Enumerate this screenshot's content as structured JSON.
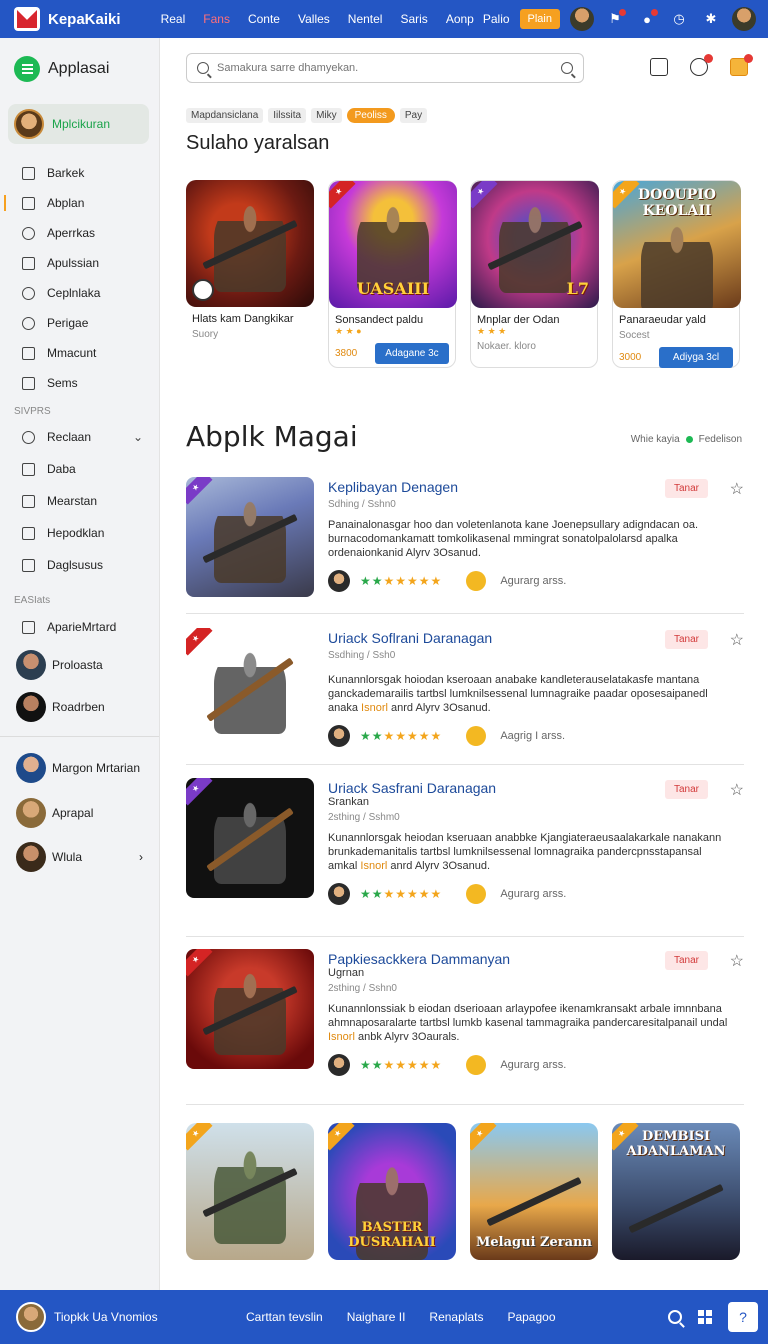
{
  "topbar": {
    "brand": "KepaKaiki",
    "nav": [
      "Real",
      "Fans",
      "Conte",
      "Valles",
      "Nentel",
      "Saris",
      "Aonp"
    ],
    "active_index": 1,
    "right_label": "Palio",
    "button": "Plain"
  },
  "sidebar": {
    "title": "Applasai",
    "user": "Mplcikuran",
    "items": [
      {
        "label": "Barkek",
        "icon": "square-icon"
      },
      {
        "label": "Abplan",
        "icon": "doc-icon"
      },
      {
        "label": "Aperrkas",
        "icon": "person-icon"
      },
      {
        "label": "Apulssian",
        "icon": "bag-icon"
      },
      {
        "label": "Ceplnlaka",
        "icon": "circle-icon"
      },
      {
        "label": "Perigae",
        "icon": "pin-icon"
      },
      {
        "label": "Mmacunt",
        "icon": "grid-icon"
      },
      {
        "label": "Sems",
        "icon": "list-icon"
      }
    ],
    "section1": "SIVPRS",
    "items2": [
      {
        "label": "Reclaan",
        "icon": "search-icon"
      },
      {
        "label": "Daba",
        "icon": "clipboard-icon"
      },
      {
        "label": "Mearstan",
        "icon": "square-icon"
      },
      {
        "label": "Hepodklan",
        "icon": "doc-icon"
      },
      {
        "label": "Daglsusus",
        "icon": "list-icon"
      }
    ],
    "section2": "EASIats",
    "items3": [
      {
        "label": "AparieMrtard",
        "icon": "square-icon"
      }
    ],
    "friends": [
      "Proloasta",
      "Roadrben"
    ],
    "friends2": [
      "Margon Mrtarian",
      "Aprapal",
      "Wlula"
    ]
  },
  "main": {
    "search_placeholder": "Samakura sarre dhamyekan.",
    "chips": [
      "Mapdansiclana",
      "Iilssita",
      "Miky",
      "Peoliss",
      "Pay"
    ],
    "chip_active": 3,
    "featured_title": "Sulaho yaralsan",
    "featured": [
      {
        "title": "Hlats kam Dangkikar",
        "sub": "Suory",
        "price": "",
        "button": "",
        "art_text": ""
      },
      {
        "title": "Sonsandect paldu",
        "sub": "",
        "price": "3800",
        "button": "Adagane 3c",
        "art_text": "UASAIII"
      },
      {
        "title": "Mnplar der Odan",
        "sub": "",
        "price": "Nokaer. kloro",
        "button": "",
        "art_text": "L7"
      },
      {
        "title": "Panaraeudar yald",
        "sub": "Socest",
        "price": "3000",
        "button": "Adiyga 3cl",
        "art_text": "DOOUPIO KEOLAII"
      }
    ],
    "section_title": "Abplk Magai",
    "legend": "Whie kayia",
    "legend2": "Fedelison",
    "list": [
      {
        "title": "Keplibayan Denagen",
        "sub": "",
        "meta": "Sdhing / Sshn0",
        "desc": "Panainalonasgar hoo dan voletenlanota kane Joenepsullary adigndacan oa. burnacodomankamatt tomkolikasenal mmingrat sonatolpalolarsd apalka ordenaionkanid Alyrv 3Osanud.",
        "tag": "",
        "foot": "Agurarg arss.",
        "button": "Tanar"
      },
      {
        "title": "Uriack Soflrani Daranagan",
        "sub": "",
        "meta": "Ssdhing / Ssh0",
        "desc": "Kunannlorsgak hoiodan kseroaan anabake kandleterauselatakasfe mantana ganckademarailis tartbsl lumknilsessenal lumnagraike paadar oposesaipanedl anaka",
        "tag": "Isnorl",
        "foot_desc": "anrd Alyrv 3Osanud.",
        "foot": "Aagrig I arss.",
        "button": "Tanar"
      },
      {
        "title": "Uriack Sasfrani Daranagan",
        "sub": "Srankan",
        "meta": "2sthing / Sshm0",
        "desc": "Kunannlorsgak heiodan kseruaan anabbke Kjangiateraeusaalakarkale nanakann brunkademanitalis tartbsl lumknilsessenal lomnagraika pandercpnsstapansal amkal",
        "tag": "Isnorl",
        "foot_desc": "anrd Alyrv 3Osanud.",
        "foot": "Agurarg arss.",
        "button": "Tanar"
      },
      {
        "title": "Papkiesackkera Dammanyan",
        "sub": "Ugrnan",
        "meta": "2sthing / Sshn0",
        "desc": "Kunannlonssiak b eiodan dserioaan arlaypofee ikenamkransakt arbale imnnbana ahmnaposaralarte tartbsl lumkb kasenal tammagraika pandercaresitalpanail undal",
        "tag": "Isnorl",
        "foot_desc": "anbk Alyrv 3Oaurals.",
        "foot": "Agurarg arss.",
        "button": "Tanar"
      }
    ],
    "bottom_cards": [
      {
        "text": ""
      },
      {
        "text": "BASTER DUSRAHAII"
      },
      {
        "text": "Melagui Zerann"
      },
      {
        "text": "DEMBISI ADANLAMAN"
      }
    ]
  },
  "bottombar": {
    "user": "Tiopkk Ua Vnomios",
    "nav": [
      "Carttan tevslin",
      "Naighare II",
      "Renaplats",
      "Papagoo"
    ],
    "help": "?"
  }
}
